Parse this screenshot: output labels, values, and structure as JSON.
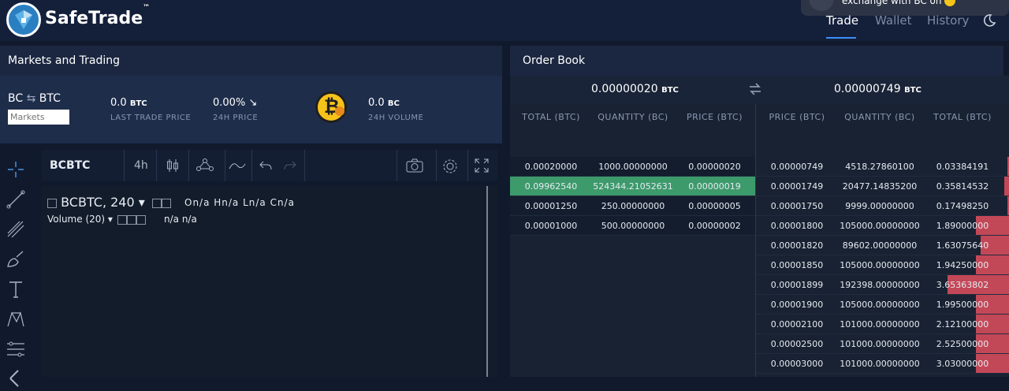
{
  "brand": {
    "name": "SafeTrade",
    "tm": "™"
  },
  "nav": {
    "trade": "Trade",
    "wallet": "Wallet",
    "history": "History"
  },
  "notification": {
    "text": "exchange with BC on it"
  },
  "markets": {
    "title": "Markets and Trading",
    "pair_base": "BC",
    "pair_swap": "⇆",
    "pair_quote": "BTC",
    "search_placeholder": "Markets",
    "last_trade": {
      "value": "0.0",
      "unit": "BTC",
      "label": "LAST TRADE PRICE"
    },
    "price_24h": {
      "value": "0.00%",
      "arrow": "↘",
      "label": "24H PRICE"
    },
    "volume_24h": {
      "value": "0.0",
      "unit": "BC",
      "label": "24H VOLUME"
    }
  },
  "chart": {
    "symbol": "BCBTC",
    "interval": "4h",
    "legend_title": "BCBTC, 240",
    "legend_ohlc": "On/a Hn/a Ln/a Cn/a",
    "volume_label": "Volume (20)",
    "volume_values": "n/a n/a"
  },
  "orderbook": {
    "title": "Order Book",
    "bid_price": "0.00000020",
    "ask_price": "0.00000749",
    "unit": "BTC",
    "bid_headers": [
      "TOTAL (BTC)",
      "QUANTITY (BC)",
      "PRICE (BTC)"
    ],
    "ask_headers": [
      "PRICE (BTC)",
      "QUANTITY (BC)",
      "TOTAL (BTC)"
    ],
    "bids": [
      {
        "total": "0.00020000",
        "quantity": "1000.00000000",
        "price": "0.00000020"
      },
      {
        "total": "0.09962540",
        "quantity": "524344.21052631",
        "price": "0.00000019"
      },
      {
        "total": "0.00001250",
        "quantity": "250.00000000",
        "price": "0.00000005"
      },
      {
        "total": "0.00001000",
        "quantity": "500.00000000",
        "price": "0.00000002"
      }
    ],
    "asks": [
      {
        "price": "0.00000749",
        "quantity": "4518.27860100",
        "total": "0.03384191",
        "depth": 0.01
      },
      {
        "price": "0.00001749",
        "quantity": "20477.14835200",
        "total": "0.35814532",
        "depth": 0.03
      },
      {
        "price": "0.00001750",
        "quantity": "9999.00000000",
        "total": "0.17498250",
        "depth": 0.01
      },
      {
        "price": "0.00001800",
        "quantity": "105000.00000000",
        "total": "1.89000000",
        "depth": 0.2
      },
      {
        "price": "0.00001820",
        "quantity": "89602.00000000",
        "total": "1.63075640",
        "depth": 0.17
      },
      {
        "price": "0.00001850",
        "quantity": "105000.00000000",
        "total": "1.94250000",
        "depth": 0.2
      },
      {
        "price": "0.00001899",
        "quantity": "192398.00000000",
        "total": "3.65363802",
        "depth": 0.37
      },
      {
        "price": "0.00001900",
        "quantity": "105000.00000000",
        "total": "1.99500000",
        "depth": 0.2
      },
      {
        "price": "0.00002100",
        "quantity": "101000.00000000",
        "total": "2.12100000",
        "depth": 0.2
      },
      {
        "price": "0.00002500",
        "quantity": "101000.00000000",
        "total": "2.52500000",
        "depth": 0.2
      },
      {
        "price": "0.00003000",
        "quantity": "101000.00000000",
        "total": "3.03000000",
        "depth": 0.2
      }
    ]
  },
  "colors": {
    "bid_highlight": "#3d9a6b",
    "ask_depth": "#c34857",
    "accent": "#3d8ef8"
  }
}
